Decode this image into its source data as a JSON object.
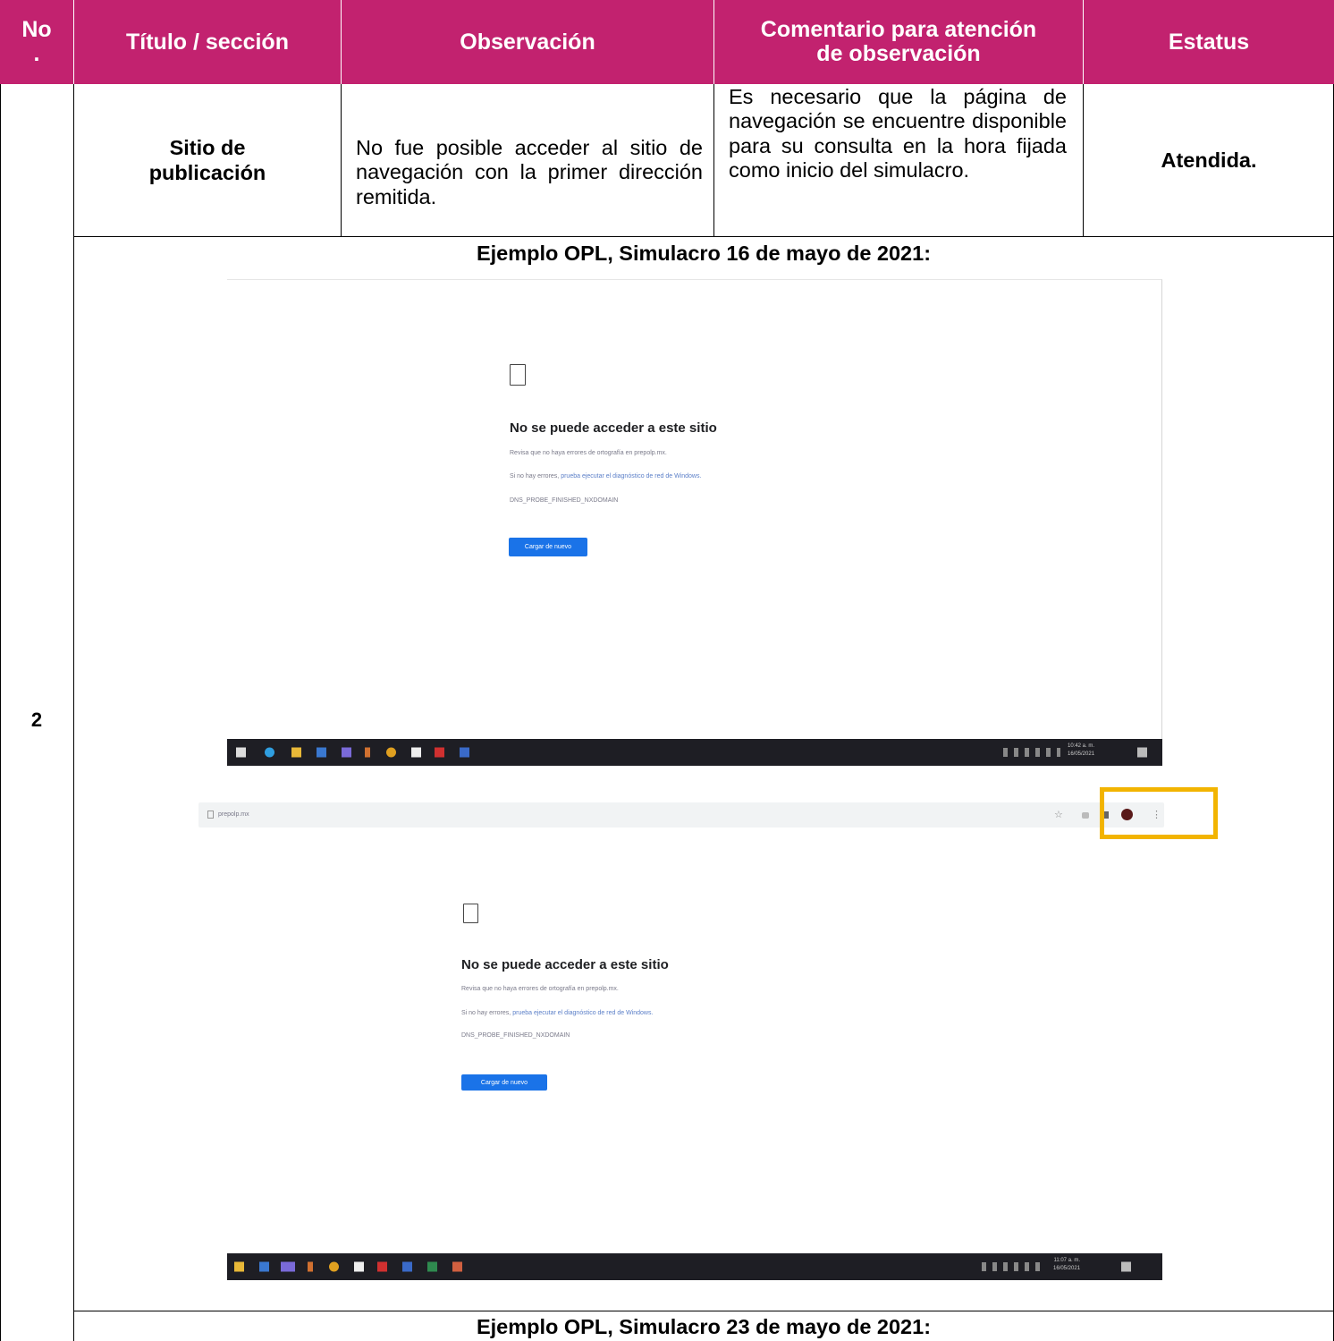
{
  "table": {
    "headers": {
      "no": "No .",
      "titulo": "Título / sección",
      "observacion": "Observación",
      "comentario": "Comentario para atención de observación",
      "estatus": "Estatus"
    },
    "row": {
      "no": "2",
      "titulo": "Sitio de publicación",
      "observacion": "No fue posible acceder al sitio de navegación con la primer dirección remitida.",
      "comentario": "Es necesario que la página de navegación se encuentre disponible para su consulta en la hora fijada como inicio del simulacro.",
      "estatus": "Atendida."
    },
    "example1_caption": "Ejemplo OPL, Simulacro 16 de mayo de 2021:",
    "example2_caption": "Ejemplo OPL, Simulacro 23 de mayo de 2021:"
  },
  "screenshot1": {
    "error_title": "No se puede acceder a este sitio",
    "line1": "Revisa que no haya errores de ortografía en prepolp.mx.",
    "line2_prefix": "Si no hay errores, ",
    "line2_link": "prueba ejecutar el diagnóstico de red de Windows.",
    "code": "DNS_PROBE_FINISHED_NXDOMAIN",
    "reload_button": "Cargar de nuevo",
    "clock": "10:42 a. m.",
    "date": "16/05/2021"
  },
  "screenshot2": {
    "url": "prepolp.mx",
    "error_title": "No se puede acceder a este sitio",
    "line1": "Revisa que no haya errores de ortografía en prepolp.mx.",
    "line2_prefix": "Si no hay errores, ",
    "line2_link": "prueba ejecutar el diagnóstico de red de Windows.",
    "code": "DNS_PROBE_FINISHED_NXDOMAIN",
    "reload_button": "Cargar de nuevo",
    "clock": "11:07 a. m.",
    "date": "16/05/2021"
  },
  "colors": {
    "header": "#c2226f",
    "highlight": "#f2b400",
    "taskbar": "#1e1e24",
    "link": "#1a73e8"
  }
}
